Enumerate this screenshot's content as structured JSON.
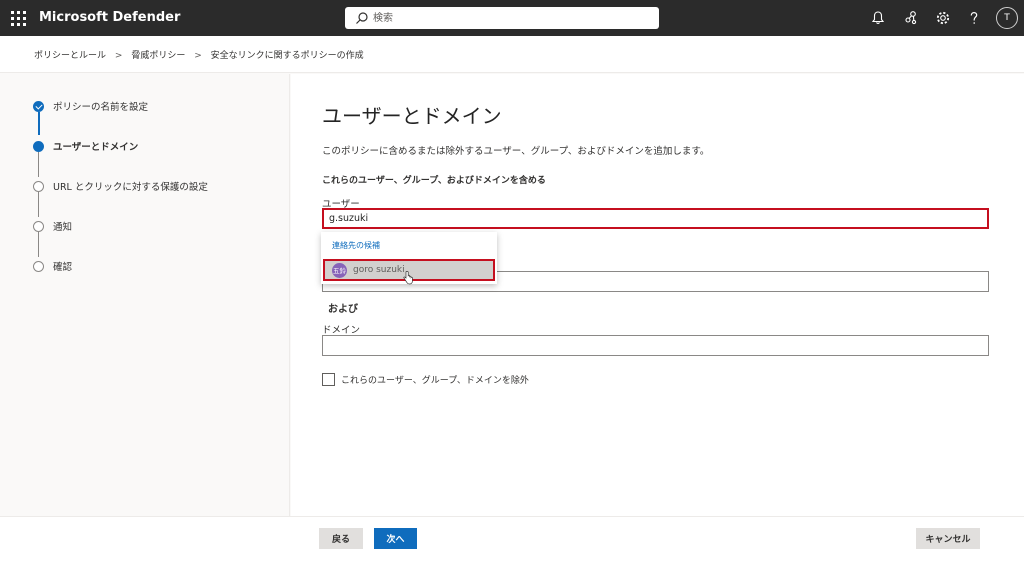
{
  "app": {
    "title": "Microsoft Defender"
  },
  "search": {
    "placeholder": "検索"
  },
  "header": {
    "avatar_initial": "T"
  },
  "breadcrumb": [
    "ポリシーとルール",
    "脅威ポリシー",
    "安全なリンクに関するポリシーの作成"
  ],
  "breadcrumb_sep": ">",
  "steps": [
    {
      "label": "ポリシーの名前を設定",
      "state": "done"
    },
    {
      "label": "ユーザーとドメイン",
      "state": "current"
    },
    {
      "label": "URL とクリックに対する保護の設定",
      "state": "pending"
    },
    {
      "label": "通知",
      "state": "pending"
    },
    {
      "label": "確認",
      "state": "pending"
    }
  ],
  "main": {
    "title": "ユーザーとドメイン",
    "description": "このポリシーに含めるまたは除外するユーザー、グループ、およびドメインを追加します。",
    "include_heading": "これらのユーザー、グループ、およびドメインを含める",
    "users_label": "ユーザー",
    "users_value": "g.suzuki",
    "groups_value": "",
    "and_label": "および",
    "domains_label": "ドメイン",
    "domains_value": "",
    "exclude_label": "これらのユーザー、グループ、ドメインを除外"
  },
  "suggestions": {
    "title": "連絡先の候補",
    "items": [
      {
        "name": "goro suzuki",
        "avatar_text": "五鈴"
      }
    ]
  },
  "footer": {
    "back_label": "戻る",
    "next_label": "次へ",
    "cancel_label": "キャンセル"
  },
  "colors": {
    "accent": "#0f6cbd",
    "highlight": "#c50f1f",
    "topbar": "#2b2b2b",
    "avatar": "#8764b8"
  }
}
